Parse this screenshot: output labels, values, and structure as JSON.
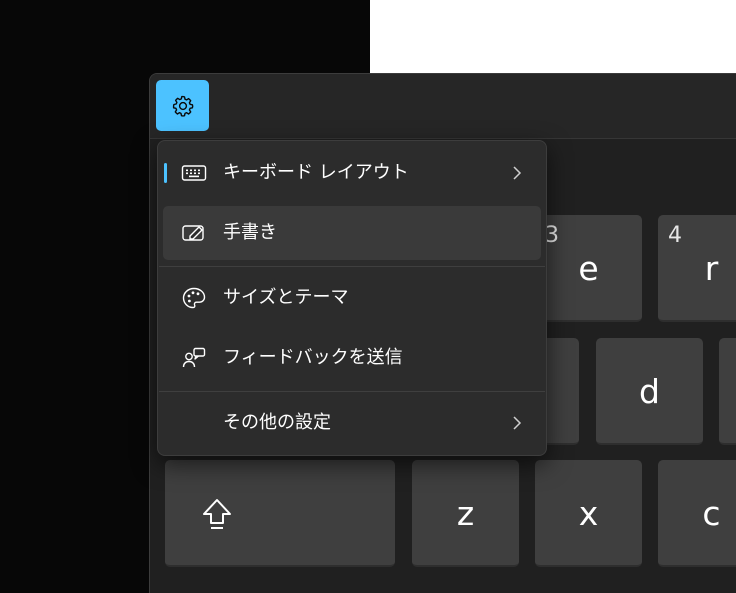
{
  "settings_icon": "gear-icon",
  "accent_color": "#4cc2ff",
  "keys": {
    "e": {
      "label": "e",
      "number": "3"
    },
    "r": {
      "label": "r",
      "number": "4"
    },
    "d": {
      "label": "d"
    },
    "z": {
      "label": "z"
    },
    "x": {
      "label": "x"
    },
    "c": {
      "label": "c"
    },
    "shift_icon": "shift-arrow-icon"
  },
  "menu": {
    "items": [
      {
        "label": "キーボード レイアウト",
        "icon": "keyboard-icon",
        "has_submenu": true,
        "selected": true
      },
      {
        "label": "手書き",
        "icon": "handwriting-icon",
        "hovered": true
      },
      {
        "label": "サイズとテーマ",
        "icon": "palette-icon"
      },
      {
        "label": "フィードバックを送信",
        "icon": "feedback-icon"
      },
      {
        "label": "その他の設定",
        "has_submenu": true
      }
    ]
  }
}
